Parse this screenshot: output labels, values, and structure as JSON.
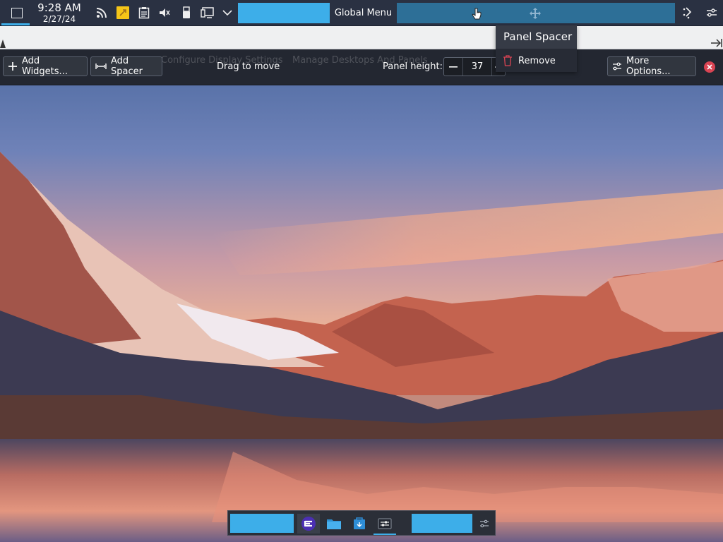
{
  "top_panel": {
    "clock": {
      "time": "9:28 AM",
      "date": "2/27/24"
    },
    "global_menu_label": "Global Menu",
    "icons": [
      "show-desktop-icon",
      "rss-feed-icon",
      "sticky-note-icon",
      "clipboard-icon",
      "volume-muted-icon",
      "usb-device-icon",
      "display-config-icon",
      "chevron-down-icon",
      "move-icon",
      "edit-mode-icon",
      "configure-icon"
    ]
  },
  "background_hints": {
    "configure_display": "Configure Display Settings",
    "manage_desktops": "Manage Desktops And Panels"
  },
  "edit_toolbar": {
    "add_widgets_label": "Add Widgets...",
    "add_spacer_label": "Add Spacer",
    "drag_to_move_label": "Drag to move",
    "panel_height_label": "Panel height:",
    "panel_height_value": "37",
    "more_options_label": "More Options..."
  },
  "popup": {
    "title": "Panel Spacer",
    "remove_label": "Remove"
  },
  "dock": {
    "icons": [
      "app-launcher-icon",
      "file-manager-icon",
      "discover-icon",
      "system-settings-icon",
      "configure-icon"
    ]
  },
  "colors": {
    "accent": "#3daee9",
    "panel_bg": "#2a3142",
    "close_red": "#da4453"
  }
}
